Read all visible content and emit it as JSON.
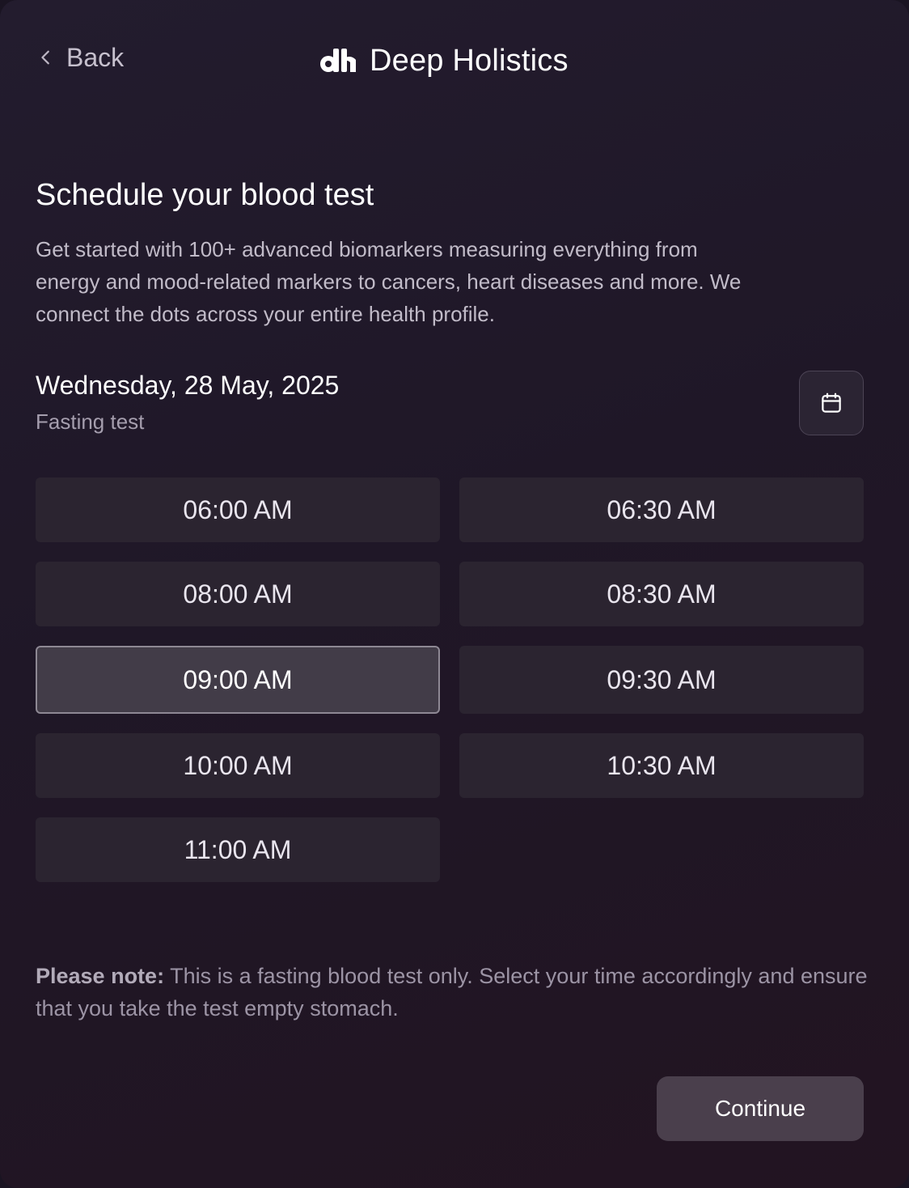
{
  "header": {
    "back_label": "Back",
    "brand_name": "Deep Holistics",
    "brand_logo_icon": "dh-logo-icon",
    "back_icon": "chevron-left-icon"
  },
  "intro": {
    "title": "Schedule your blood test",
    "description": "Get started with 100+ advanced biomarkers measuring everything from energy and mood-related markers to cancers, heart diseases and more. We connect the dots across your entire health profile."
  },
  "schedule": {
    "date": "Wednesday, 28 May, 2025",
    "test_type": "Fasting test",
    "calendar_icon": "calendar-icon",
    "selected_slot": "09:00 AM",
    "slots": [
      {
        "label": "06:00 AM"
      },
      {
        "label": "06:30 AM"
      },
      {
        "label": "08:00 AM"
      },
      {
        "label": "08:30 AM"
      },
      {
        "label": "09:00 AM"
      },
      {
        "label": "09:30 AM"
      },
      {
        "label": "10:00 AM"
      },
      {
        "label": "10:30 AM"
      },
      {
        "label": "11:00 AM"
      }
    ]
  },
  "note": {
    "prefix": "Please note:",
    "text": " This is a fasting blood test only. Select your time accordingly and ensure that you take the test empty stomach."
  },
  "actions": {
    "continue_label": "Continue"
  },
  "colors": {
    "background": "#1f1727",
    "slot_bg": "#2b2430",
    "slot_selected_bg": "#423c48",
    "continue_bg": "#4a3f4c"
  }
}
